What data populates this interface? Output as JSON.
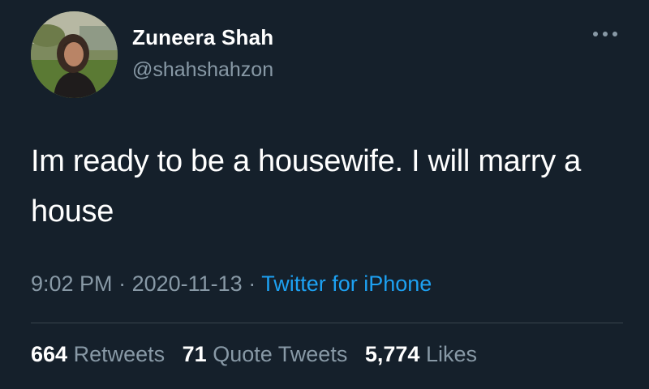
{
  "tweet": {
    "author": {
      "display_name": "Zuneera Shah",
      "handle": "@shahshahzon",
      "avatar": "profile-photo"
    },
    "text": "Im ready to be a housewife. I will marry a house",
    "time": "9:02 PM",
    "separator": "·",
    "date": "2020-11-13",
    "source": "Twitter for iPhone",
    "stats": {
      "retweets_count": "664",
      "retweets_label": "Retweets",
      "quotes_count": "71",
      "quotes_label": "Quote Tweets",
      "likes_count": "5,774",
      "likes_label": "Likes"
    },
    "more_icon": "more-horizontal-icon"
  },
  "colors": {
    "background": "#15202b",
    "text_primary": "#ffffff",
    "text_secondary": "#8899a6",
    "link": "#1da1f2",
    "divider": "#38444d"
  }
}
